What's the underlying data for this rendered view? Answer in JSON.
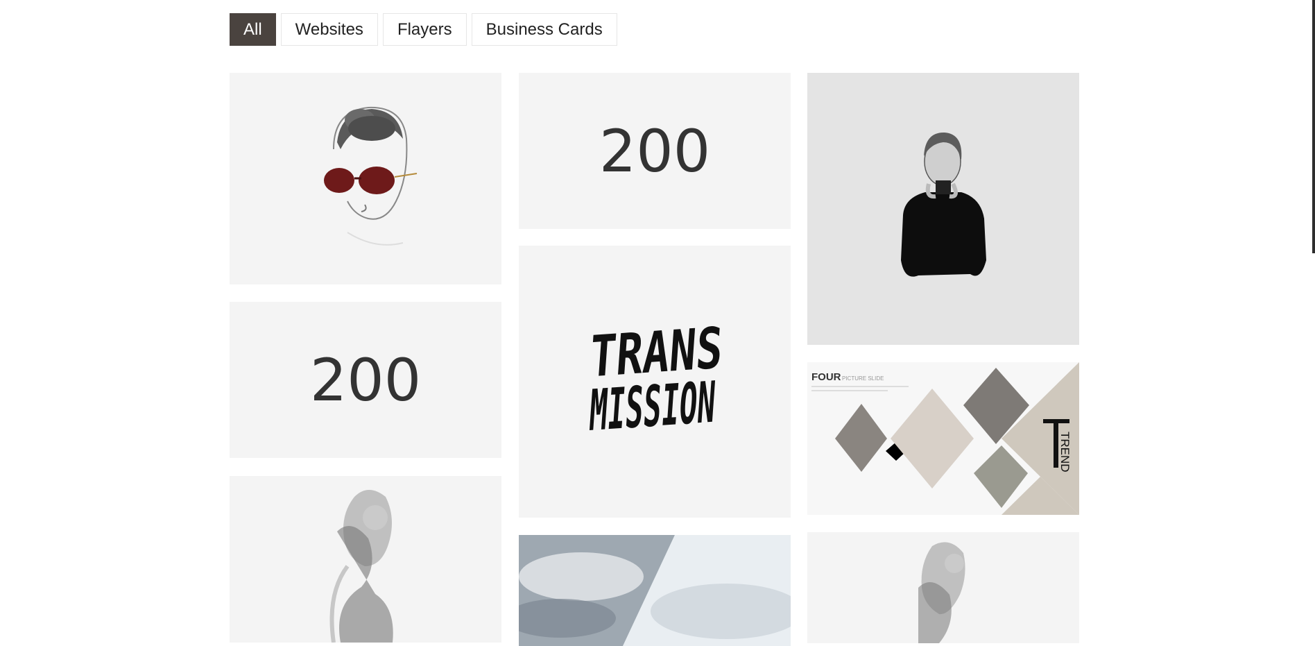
{
  "filters": [
    {
      "label": "All",
      "active": true
    },
    {
      "label": "Websites",
      "active": false
    },
    {
      "label": "Flayers",
      "active": false
    },
    {
      "label": "Business Cards",
      "active": false
    }
  ],
  "portfolio": {
    "items": [
      {
        "subject": "woman-with-sunglasses-illustration"
      },
      {
        "subject": "200-logo",
        "text": "200"
      },
      {
        "subject": "woman-black-sweater-photo"
      },
      {
        "subject": "200-logo",
        "text": "200"
      },
      {
        "subject": "transmission-typography",
        "line1": "TRANS",
        "line2": "MISSION"
      },
      {
        "subject": "four-picture-slide",
        "title": "FOUR",
        "subtitle": "PICTURE SLIDE",
        "trend": "TREND"
      },
      {
        "subject": "double-exposure-portrait"
      },
      {
        "subject": "sky-photo"
      },
      {
        "subject": "double-exposure-portrait"
      }
    ]
  },
  "colors": {
    "active_filter": "#4a433f",
    "tile_bg": "#f4f4f4"
  }
}
